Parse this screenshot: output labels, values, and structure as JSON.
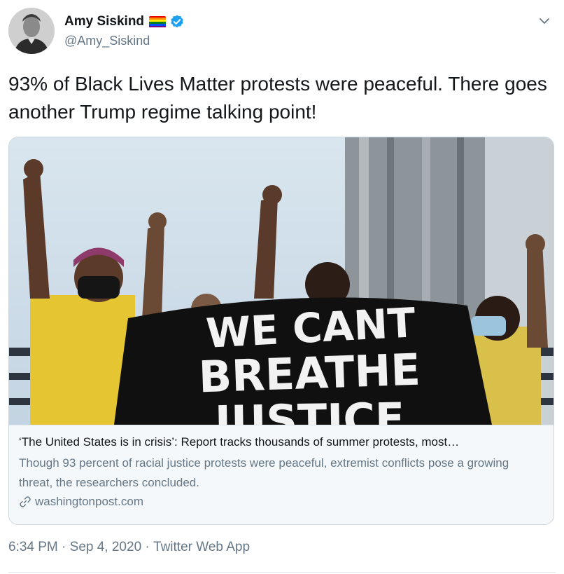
{
  "author": {
    "display_name": "Amy Siskind",
    "handle": "@Amy_Siskind",
    "flag_colors": [
      "#e40303",
      "#ff8c00",
      "#ffed00",
      "#008026",
      "#004dff",
      "#750787"
    ],
    "verified_color": "#1da1f2"
  },
  "tweet": {
    "text": "93% of Black Lives Matter protests were peaceful. There goes another Trump regime talking point!"
  },
  "card": {
    "image_sign_text": [
      "WE CANT",
      "BREATHE",
      "JUSTICE"
    ],
    "title": "‘The United States is in crisis’: Report tracks thousands of summer protests, most…",
    "description": "Though 93 percent of racial justice protests were peaceful, extremist conflicts pose a growing threat, the researchers concluded.",
    "domain": "washingtonpost.com"
  },
  "meta": {
    "time": "6:34 PM",
    "separator": " · ",
    "date": "Sep 4, 2020",
    "source": "Twitter Web App"
  },
  "colors": {
    "text_primary": "#14171a",
    "text_secondary": "#657786",
    "accent": "#1da1f2",
    "border": "#ccd6dd"
  },
  "icons": [
    "avatar-photo",
    "pride-flag-icon",
    "verified-badge-icon",
    "chevron-down-icon",
    "link-icon"
  ]
}
